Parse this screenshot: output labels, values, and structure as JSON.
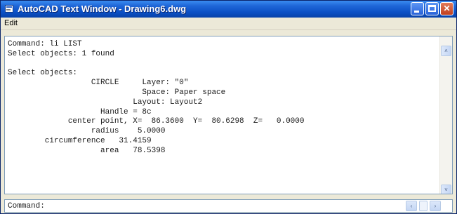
{
  "window": {
    "title": "AutoCAD Text Window - Drawing6.dwg",
    "app_icon": "autocad-text-window-icon",
    "controls": {
      "minimize": "minimize-icon",
      "maximize": "maximize-icon",
      "close": "close-icon",
      "close_glyph": "✕"
    }
  },
  "menu": {
    "items": [
      "Edit"
    ]
  },
  "text_window": {
    "lines": [
      "Command: li LIST",
      "Select objects: 1 found",
      "",
      "Select objects:",
      "                  CIRCLE     Layer: \"0\"",
      "                             Space: Paper space",
      "                           Layout: Layout2",
      "                    Handle = 8c",
      "             center point, X=  86.3600  Y=  80.6298  Z=   0.0000",
      "                  radius    5.0000",
      "        circumference   31.4159",
      "                    area   78.5398"
    ],
    "scroll_up_glyph": "˄",
    "scroll_down_glyph": "˅"
  },
  "command_line": {
    "prompt": "Command:",
    "scroll_left_glyph": "‹",
    "scroll_right_glyph": "›"
  },
  "colors": {
    "title_bar": "#0a4fc4",
    "window_bg": "#ece9d8",
    "text_bg": "#ffffff",
    "close_button": "#c0401f"
  }
}
